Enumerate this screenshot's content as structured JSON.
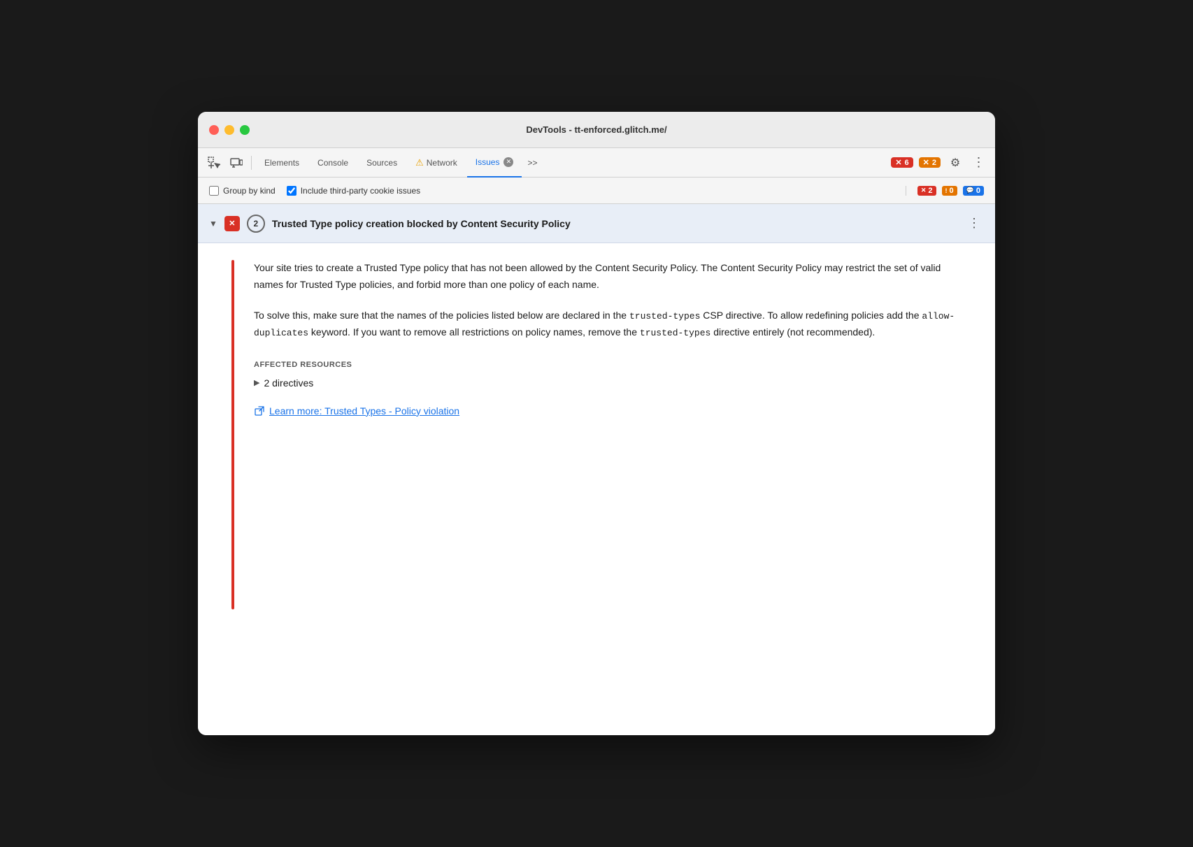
{
  "window": {
    "title": "DevTools - tt-enforced.glitch.me/"
  },
  "titlebar": {
    "close_btn": "close",
    "minimize_btn": "minimize",
    "maximize_btn": "maximize"
  },
  "toolbar": {
    "inspect_icon": "⬚",
    "device_icon": "⬜",
    "elements_label": "Elements",
    "console_label": "Console",
    "sources_label": "Sources",
    "network_label": "Network",
    "issues_label": "Issues",
    "more_tabs_label": ">>",
    "badge_red_count": "6",
    "badge_orange_count": "2",
    "settings_icon": "⚙",
    "more_icon": "⋮"
  },
  "secondary_toolbar": {
    "group_by_kind_label": "Group by kind",
    "group_by_kind_checked": false,
    "include_third_party_label": "Include third-party cookie issues",
    "include_third_party_checked": true,
    "badge_red_count": "2",
    "badge_orange_count": "0",
    "badge_blue_count": "0"
  },
  "issue": {
    "badge_icon": "✕",
    "count": "2",
    "title": "Trusted Type policy creation blocked by Content Security Policy",
    "description": "Your site tries to create a Trusted Type policy that has not been allowed by the Content Security Policy. The Content Security Policy may restrict the set of valid names for Trusted Type policies, and forbid more than one policy of each name.",
    "solution_part1": "To solve this, make sure that the names of the policies listed below are declared in the ",
    "solution_code1": "trusted-types",
    "solution_part2": " CSP directive. To allow redefining policies add the ",
    "solution_code2": "allow-duplicates",
    "solution_part3": " keyword. If you want to remove all restrictions on policy names, remove the ",
    "solution_code3": "trusted-types",
    "solution_part4": " directive entirely (not recommended).",
    "affected_resources_label": "AFFECTED RESOURCES",
    "directives_label": "2 directives",
    "learn_more_label": "Learn more: Trusted Types - Policy violation"
  }
}
